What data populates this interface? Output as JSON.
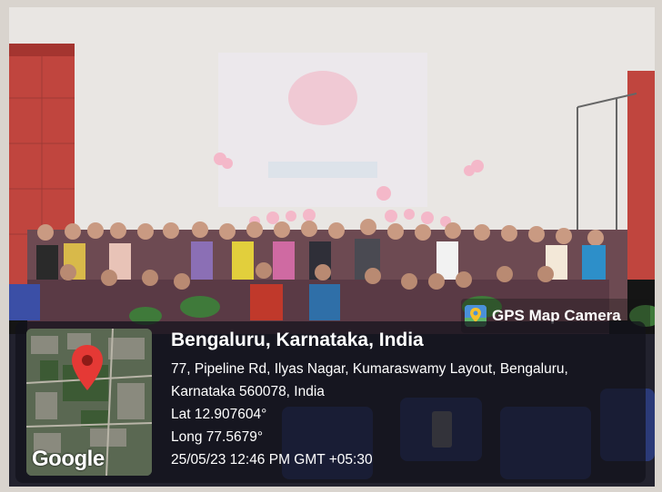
{
  "app_badge": {
    "label": "GPS Map Camera",
    "icon": "map-pin-icon",
    "color": "#4a90d9"
  },
  "map": {
    "watermark": "Google",
    "marker_icon": "map-marker-icon",
    "marker_color": "#e53935"
  },
  "location": {
    "title": "Bengaluru, Karnataka, India",
    "address_line1": "77, Pipeline Rd, Ilyas Nagar, Kumaraswamy Layout, Bengaluru,",
    "address_line2": "Karnataka 560078, India",
    "lat": "Lat 12.907604°",
    "long": "Long 77.5679°",
    "timestamp": "25/05/23 12:46 PM GMT +05:30"
  }
}
